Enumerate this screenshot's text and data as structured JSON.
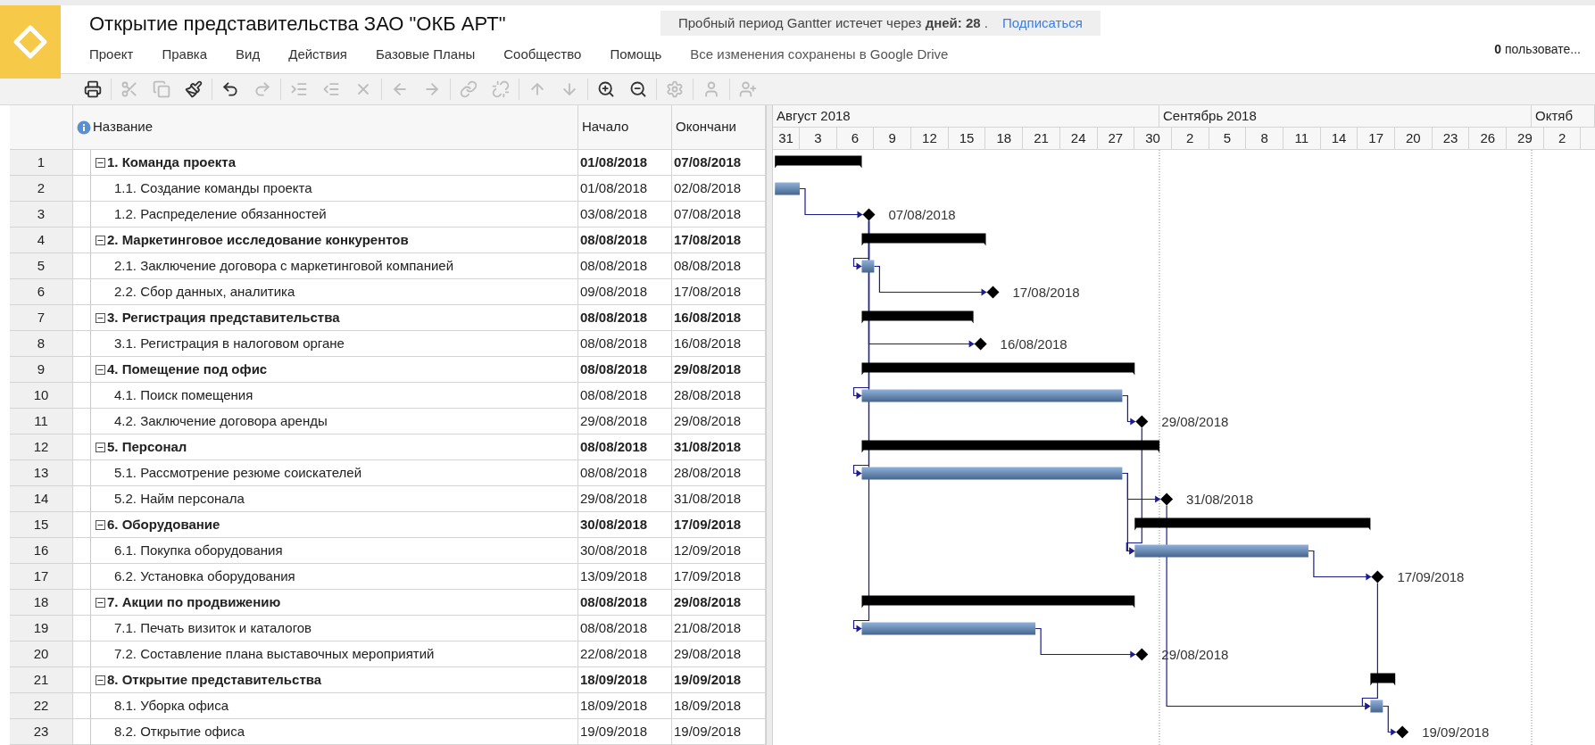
{
  "app": {
    "title": "Открытие представительства ЗАО \"ОКБ АРТ\"",
    "trial_notice": "Пробный период Gantter истечет через **дней: 28** .",
    "subscribe_link": "Подписаться",
    "menu": [
      "Проект",
      "Правка",
      "Вид",
      "Действия",
      "Базовые Планы",
      "Сообщество",
      "Помощь"
    ],
    "save_status": "Все изменения сохранены в Google Drive",
    "users": "**0** пользовате..."
  },
  "toolbar": [
    [
      {
        "kind": "print",
        "disabled": false
      }
    ],
    [
      {
        "kind": "cut",
        "disabled": true
      },
      {
        "kind": "copy",
        "disabled": true
      },
      {
        "kind": "format",
        "disabled": false
      }
    ],
    [
      {
        "kind": "undo",
        "disabled": false
      },
      {
        "kind": "redo",
        "disabled": true
      }
    ],
    [
      {
        "kind": "indent",
        "disabled": true
      },
      {
        "kind": "outdent",
        "disabled": true
      },
      {
        "kind": "delete",
        "disabled": true
      }
    ],
    [
      {
        "kind": "move_left",
        "disabled": true
      },
      {
        "kind": "move_right",
        "disabled": true
      }
    ],
    [
      {
        "kind": "link",
        "disabled": true
      },
      {
        "kind": "unlink",
        "disabled": true
      }
    ],
    [
      {
        "kind": "move_up",
        "disabled": true
      },
      {
        "kind": "move_down",
        "disabled": true
      }
    ],
    [
      {
        "kind": "zoom_in",
        "disabled": false
      },
      {
        "kind": "zoom_out",
        "disabled": false
      }
    ],
    [
      {
        "kind": "settings",
        "disabled": true
      }
    ],
    [
      {
        "kind": "user",
        "disabled": true
      }
    ],
    [
      {
        "kind": "add_user",
        "disabled": true
      }
    ]
  ],
  "table": {
    "columns": [
      "Название",
      "Начало",
      "Окончани"
    ],
    "rows": [
      {
        "number": "1",
        "kind": "summary",
        "expanded": true,
        "name": "1. Команда проекта",
        "start": "01/08/2018",
        "end": "07/08/2018"
      },
      {
        "number": "2",
        "kind": "task",
        "name": "1.1. Создание команды проекта",
        "start": "01/08/2018",
        "end": "02/08/2018"
      },
      {
        "number": "3",
        "kind": "milestone",
        "name": "1.2. Распределение обязанностей",
        "start": "03/08/2018",
        "end": "07/08/2018",
        "chart_label": "07/08/2018"
      },
      {
        "number": "4",
        "kind": "summary",
        "expanded": true,
        "name": "2. Маркетинговое исследование конкурентов",
        "start": "08/08/2018",
        "end": "17/08/2018"
      },
      {
        "number": "5",
        "kind": "task",
        "name": "2.1. Заключение договора с маркетинговой компанией",
        "start": "08/08/2018",
        "end": "08/08/2018"
      },
      {
        "number": "6",
        "kind": "milestone",
        "name": "2.2. Сбор данных, аналитика",
        "start": "09/08/2018",
        "end": "17/08/2018",
        "chart_label": "17/08/2018"
      },
      {
        "number": "7",
        "kind": "summary",
        "expanded": true,
        "name": "3. Регистрация представительства",
        "start": "08/08/2018",
        "end": "16/08/2018"
      },
      {
        "number": "8",
        "kind": "milestone",
        "name": "3.1. Регистрация в налоговом органе",
        "start": "08/08/2018",
        "end": "16/08/2018",
        "chart_label": "16/08/2018"
      },
      {
        "number": "9",
        "kind": "summary",
        "expanded": true,
        "name": "4. Помещение под офис",
        "start": "08/08/2018",
        "end": "29/08/2018"
      },
      {
        "number": "10",
        "kind": "task",
        "name": "4.1. Поиск помещения",
        "start": "08/08/2018",
        "end": "28/08/2018"
      },
      {
        "number": "11",
        "kind": "milestone",
        "name": "4.2. Заключение договора аренды",
        "start": "29/08/2018",
        "end": "29/08/2018",
        "chart_label": "29/08/2018"
      },
      {
        "number": "12",
        "kind": "summary",
        "expanded": true,
        "name": "5. Персонал",
        "start": "08/08/2018",
        "end": "31/08/2018"
      },
      {
        "number": "13",
        "kind": "task",
        "name": "5.1. Рассмотрение резюме соискателей",
        "start": "08/08/2018",
        "end": "28/08/2018"
      },
      {
        "number": "14",
        "kind": "milestone",
        "name": "5.2. Найм персонала",
        "start": "29/08/2018",
        "end": "31/08/2018",
        "chart_label": "31/08/2018"
      },
      {
        "number": "15",
        "kind": "summary",
        "expanded": true,
        "name": "6. Оборудование",
        "start": "30/08/2018",
        "end": "17/09/2018"
      },
      {
        "number": "16",
        "kind": "task",
        "name": "6.1. Покупка оборудования",
        "start": "30/08/2018",
        "end": "12/09/2018"
      },
      {
        "number": "17",
        "kind": "milestone",
        "name": "6.2. Установка оборудования",
        "start": "13/09/2018",
        "end": "17/09/2018",
        "chart_label": "17/09/2018"
      },
      {
        "number": "18",
        "kind": "summary",
        "expanded": true,
        "name": "7. Акции по продвижению",
        "start": "08/08/2018",
        "end": "29/08/2018"
      },
      {
        "number": "19",
        "kind": "task",
        "name": "7.1. Печать визиток и каталогов",
        "start": "08/08/2018",
        "end": "21/08/2018"
      },
      {
        "number": "20",
        "kind": "milestone",
        "name": "7.2. Составление плана выставочных мероприятий",
        "start": "22/08/2018",
        "end": "29/08/2018",
        "chart_label": "29/08/2018"
      },
      {
        "number": "21",
        "kind": "summary",
        "expanded": true,
        "name": "8. Открытие представительства",
        "start": "18/09/2018",
        "end": "19/09/2018"
      },
      {
        "number": "22",
        "kind": "task",
        "name": "8.1. Уборка офиса",
        "start": "18/09/2018",
        "end": "18/09/2018"
      },
      {
        "number": "23",
        "kind": "milestone",
        "name": "8.2. Открытие офиса",
        "start": "19/09/2018",
        "end": "19/09/2018",
        "chart_label": "19/09/2018"
      }
    ]
  },
  "gantt": {
    "months": [
      "Август 2018",
      "Сентябрь 2018",
      "Октяб"
    ],
    "days": [
      "31",
      "3",
      "6",
      "9",
      "12",
      "15",
      "18",
      "21",
      "24",
      "27",
      "30",
      "2",
      "5",
      "8",
      "11",
      "14",
      "17",
      "20",
      "23",
      "26",
      "29",
      "2"
    ]
  }
}
